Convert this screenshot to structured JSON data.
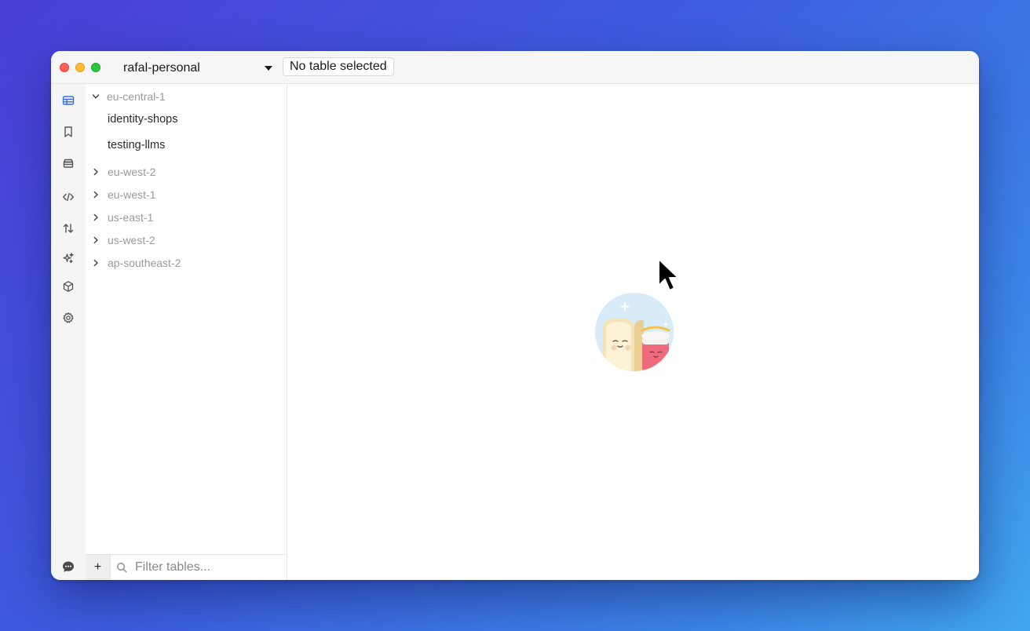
{
  "titlebar": {
    "profile": "rafal-personal",
    "table_chip": "No table selected"
  },
  "rail": {
    "icons": [
      "tables-icon",
      "bookmark-icon",
      "database-icon",
      "code-icon",
      "transfer-icon",
      "sparkles-icon",
      "cube-icon",
      "gear-icon",
      "chat-icon"
    ],
    "active": "tables-icon",
    "accent": "#3a6ee8"
  },
  "sidebar": {
    "regions": [
      {
        "name": "eu-central-1",
        "expanded": true,
        "tables": [
          "identity-shops",
          "testing-llms"
        ]
      },
      {
        "name": "eu-west-2",
        "expanded": false
      },
      {
        "name": "eu-west-1",
        "expanded": false
      },
      {
        "name": "us-east-1",
        "expanded": false
      },
      {
        "name": "us-west-2",
        "expanded": false
      },
      {
        "name": "ap-southeast-2",
        "expanded": false
      }
    ],
    "add_label": "+",
    "filter_placeholder": "Filter tables..."
  }
}
